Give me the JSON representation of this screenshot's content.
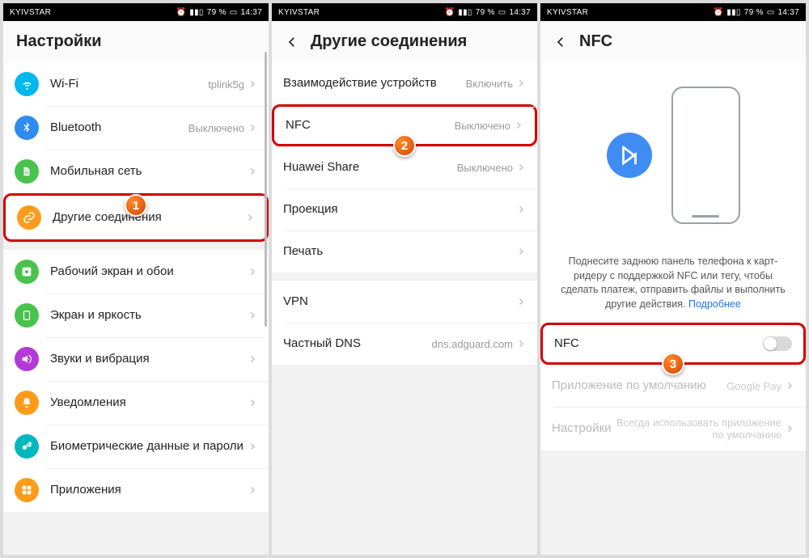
{
  "status": {
    "carrier": "KYIVSTAR",
    "battery": "79 %",
    "time": "14:37"
  },
  "p1": {
    "title": "Настройки",
    "g1": [
      {
        "icon": "wifi",
        "color": "#00b7f0",
        "label": "Wi-Fi",
        "value": "tplink5g"
      },
      {
        "icon": "bt",
        "color": "#2e8cf0",
        "label": "Bluetooth",
        "value": "Выключено"
      },
      {
        "icon": "sim",
        "color": "#4ac24e",
        "label": "Мобильная сеть",
        "value": ""
      },
      {
        "icon": "link",
        "color": "#ff9b1a",
        "label": "Другие соединения",
        "value": "",
        "hl": true
      }
    ],
    "g2": [
      {
        "icon": "home",
        "color": "#4ac24e",
        "label": "Рабочий экран и обои",
        "value": ""
      },
      {
        "icon": "bright",
        "color": "#4ac24e",
        "label": "Экран и яркость",
        "value": ""
      },
      {
        "icon": "sound",
        "color": "#b23bd8",
        "label": "Звуки и вибрация",
        "value": ""
      },
      {
        "icon": "bell",
        "color": "#ff9b1a",
        "label": "Уведомления",
        "value": ""
      },
      {
        "icon": "key",
        "color": "#00b7bd",
        "label": "Биометрические данные и пароли",
        "value": ""
      },
      {
        "icon": "apps",
        "color": "#ff9b1a",
        "label": "Приложения",
        "value": ""
      }
    ],
    "step": "1"
  },
  "p2": {
    "title": "Другие соединения",
    "g1": [
      {
        "label": "Взаимодействие устройств",
        "value": "Включить"
      },
      {
        "label": "NFC",
        "value": "Выключено",
        "hl": true
      },
      {
        "label": "Huawei Share",
        "value": "Выключено"
      },
      {
        "label": "Проекция",
        "value": ""
      },
      {
        "label": "Печать",
        "value": ""
      }
    ],
    "g2": [
      {
        "label": "VPN",
        "value": ""
      },
      {
        "label": "Частный DNS",
        "value": "dns.adguard.com"
      }
    ],
    "step": "2"
  },
  "p3": {
    "title": "NFC",
    "desc": "Поднесите заднюю панель телефона к карт-ридеру с поддержкой NFC или тегу, чтобы сделать платеж, отправить файлы и выполнить другие действия.",
    "more": "Подробнее",
    "rows": [
      {
        "label": "NFC",
        "toggle": true,
        "hl": true
      },
      {
        "label": "Приложение по умолчанию",
        "value": "Google Pay",
        "disabled": true
      },
      {
        "label": "Настройки",
        "value": "Всегда использовать приложение по умолчанию",
        "disabled": true
      }
    ],
    "step": "3"
  }
}
